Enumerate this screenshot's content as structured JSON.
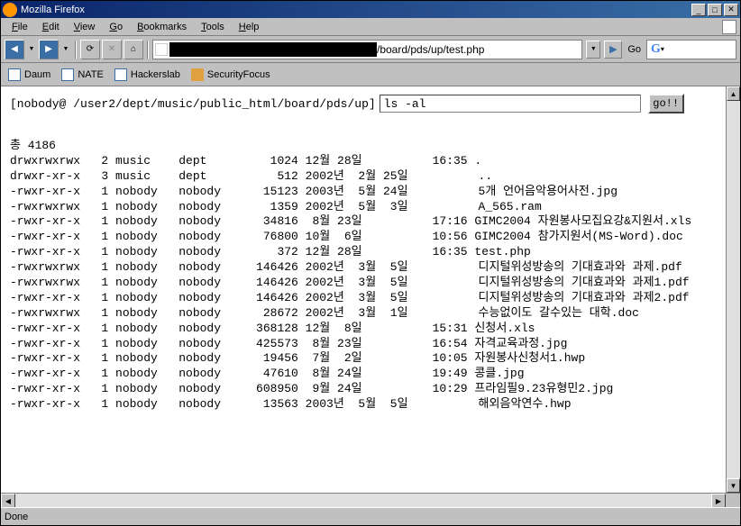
{
  "window": {
    "title": "Mozilla Firefox"
  },
  "menu": {
    "file": "File",
    "edit": "Edit",
    "view": "View",
    "go": "Go",
    "bookmarks": "Bookmarks",
    "tools": "Tools",
    "help": "Help"
  },
  "toolbar": {
    "url_visible": "/board/pds/up/test.php",
    "go_label": "Go"
  },
  "bookmarks": {
    "items": [
      "Daum",
      "NATE",
      "Hackerslab",
      "SecurityFocus"
    ]
  },
  "shell": {
    "prompt": "[nobody@ /user2/dept/music/public_html/board/pds/up]",
    "command": "ls -al",
    "go_button": "go!!"
  },
  "listing": {
    "total": "총 4186",
    "rows": [
      {
        "perm": "drwxrwxrwx",
        "n": "2",
        "owner": "music",
        "group": "dept",
        "size": "1024",
        "date": "12월 28일",
        "time": "16:35",
        "name": "."
      },
      {
        "perm": "drwxr-xr-x",
        "n": "3",
        "owner": "music",
        "group": "dept",
        "size": "512",
        "date": "2002년  2월 25일",
        "time": "",
        "name": ".."
      },
      {
        "perm": "-rwxr-xr-x",
        "n": "1",
        "owner": "nobody",
        "group": "nobody",
        "size": "15123",
        "date": "2003년  5월 24일",
        "time": "",
        "name": "5개 언어음악용어사전.jpg"
      },
      {
        "perm": "-rwxrwxrwx",
        "n": "1",
        "owner": "nobody",
        "group": "nobody",
        "size": "1359",
        "date": "2002년  5월  3일",
        "time": "",
        "name": "A_565.ram"
      },
      {
        "perm": "-rwxr-xr-x",
        "n": "1",
        "owner": "nobody",
        "group": "nobody",
        "size": "34816",
        "date": " 8월 23일",
        "time": "17:16",
        "name": "GIMC2004 자원봉사모집요강&지원서.xls"
      },
      {
        "perm": "-rwxr-xr-x",
        "n": "1",
        "owner": "nobody",
        "group": "nobody",
        "size": "76800",
        "date": "10월  6일",
        "time": "10:56",
        "name": "GIMC2004 참가지원서(MS-Word).doc"
      },
      {
        "perm": "-rwxr-xr-x",
        "n": "1",
        "owner": "nobody",
        "group": "nobody",
        "size": "372",
        "date": "12월 28일",
        "time": "16:35",
        "name": "test.php"
      },
      {
        "perm": "-rwxrwxrwx",
        "n": "1",
        "owner": "nobody",
        "group": "nobody",
        "size": "146426",
        "date": "2002년  3월  5일",
        "time": "",
        "name": "디지털위성방송의 기대효과와 과제.pdf"
      },
      {
        "perm": "-rwxrwxrwx",
        "n": "1",
        "owner": "nobody",
        "group": "nobody",
        "size": "146426",
        "date": "2002년  3월  5일",
        "time": "",
        "name": "디지털위성방송의 기대효과와 과제1.pdf"
      },
      {
        "perm": "-rwxr-xr-x",
        "n": "1",
        "owner": "nobody",
        "group": "nobody",
        "size": "146426",
        "date": "2002년  3월  5일",
        "time": "",
        "name": "디지털위성방송의 기대효과와 과제2.pdf"
      },
      {
        "perm": "-rwxrwxrwx",
        "n": "1",
        "owner": "nobody",
        "group": "nobody",
        "size": "28672",
        "date": "2002년  3월  1일",
        "time": "",
        "name": "수능없이도 갈수있는 대학.doc"
      },
      {
        "perm": "-rwxr-xr-x",
        "n": "1",
        "owner": "nobody",
        "group": "nobody",
        "size": "368128",
        "date": "12월  8일",
        "time": "15:31",
        "name": "신청서.xls"
      },
      {
        "perm": "-rwxr-xr-x",
        "n": "1",
        "owner": "nobody",
        "group": "nobody",
        "size": "425573",
        "date": " 8월 23일",
        "time": "16:54",
        "name": "자격교육과정.jpg"
      },
      {
        "perm": "-rwxr-xr-x",
        "n": "1",
        "owner": "nobody",
        "group": "nobody",
        "size": "19456",
        "date": " 7월  2일",
        "time": "10:05",
        "name": "자원봉사신청서1.hwp"
      },
      {
        "perm": "-rwxr-xr-x",
        "n": "1",
        "owner": "nobody",
        "group": "nobody",
        "size": "47610",
        "date": " 8월 24일",
        "time": "19:49",
        "name": "콩클.jpg"
      },
      {
        "perm": "-rwxr-xr-x",
        "n": "1",
        "owner": "nobody",
        "group": "nobody",
        "size": "608950",
        "date": " 9월 24일",
        "time": "10:29",
        "name": "프라임필9.23유형민2.jpg"
      },
      {
        "perm": "-rwxr-xr-x",
        "n": "1",
        "owner": "nobody",
        "group": "nobody",
        "size": "13563",
        "date": "2003년  5월  5일",
        "time": "",
        "name": "해외음악연수.hwp"
      }
    ]
  },
  "statusbar": {
    "text": "Done"
  }
}
